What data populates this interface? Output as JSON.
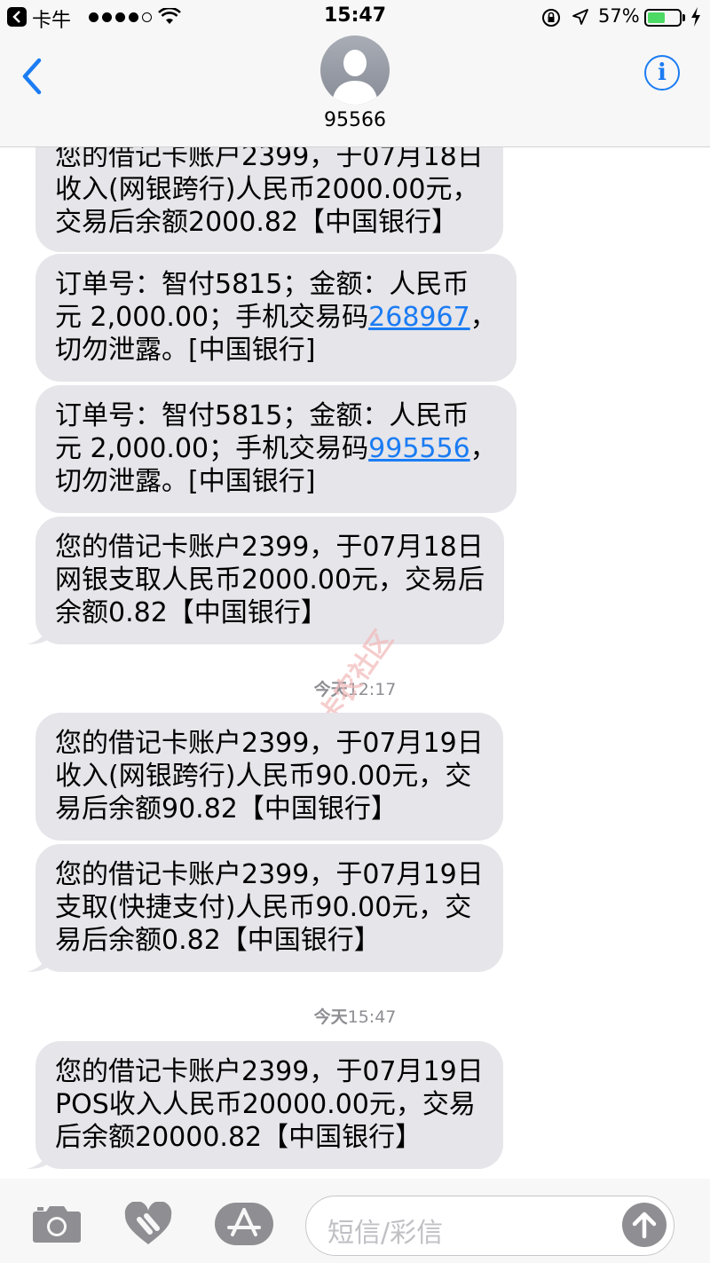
{
  "status_bar": {
    "app_name": "卡牛",
    "signal_bars": 4,
    "signal_total": 5,
    "time": "15:47",
    "battery_percent_label": "57%",
    "battery_level": 0.57,
    "battery_color": "#4cd964"
  },
  "header": {
    "contact_name": "95566",
    "back_icon": "chevron-left-icon",
    "info_icon": "info-icon",
    "info_glyph": "i",
    "accent_color": "#1b7cf3"
  },
  "messages": [
    {
      "parts": [
        {
          "text": "您的借记卡账户2399，于07月18日\n收入(网银跨行)人民币2000.00元，\n交易后余额2000.82【中国银行】"
        }
      ]
    },
    {
      "parts": [
        {
          "text": "订单号：智付5815；金额：人民币\n元 2,000.00；手机交易码"
        },
        {
          "text": "268967",
          "link": true
        },
        {
          "text": "，\n切勿泄露。[中国银行]"
        }
      ]
    },
    {
      "parts": [
        {
          "text": "订单号：智付5815；金额：人民币\n元 2,000.00；手机交易码"
        },
        {
          "text": "995556",
          "link": true
        },
        {
          "text": "，\n切勿泄露。[中国银行]"
        }
      ]
    },
    {
      "parts": [
        {
          "text": "您的借记卡账户2399，于07月18日\n网银支取人民币2000.00元，交易后\n余额0.82【中国银行】"
        }
      ]
    },
    {
      "parts": [
        {
          "text": "您的借记卡账户2399，于07月19日\n收入(网银跨行)人民币90.00元，交\n易后余额90.82【中国银行】"
        }
      ]
    },
    {
      "parts": [
        {
          "text": "您的借记卡账户2399，于07月19日\n支取(快捷支付)人民币90.00元，交\n易后余额0.82【中国银行】"
        }
      ]
    },
    {
      "parts": [
        {
          "text": "您的借记卡账户2399，于07月19日\nPOS收入人民币20000.00元，交易\n后余额20000.82【中国银行】"
        }
      ]
    }
  ],
  "timestamps": [
    {
      "day": "今天",
      "time": "12:17"
    },
    {
      "day": "今天",
      "time": "15:47"
    }
  ],
  "watermark": "卡农社区",
  "input_bar": {
    "placeholder": "短信/彩信",
    "camera_icon": "camera-icon",
    "digital_touch_icon": "heart-hands-icon",
    "app_store_icon": "app-store-icon",
    "send_icon": "arrow-up-icon"
  }
}
